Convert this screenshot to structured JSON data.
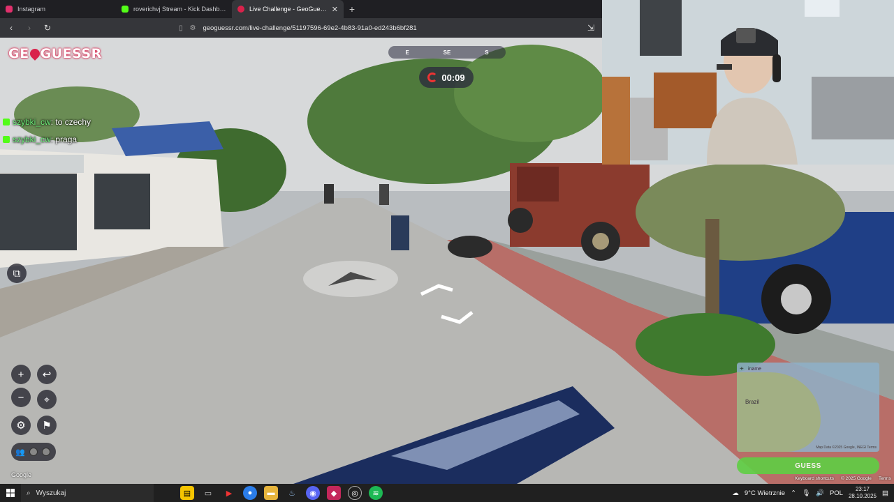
{
  "browser": {
    "tabs": [
      {
        "label": "Instagram",
        "color": "#e1306c",
        "active": false
      },
      {
        "label": "roverichvj Stream - Kick Dashboard",
        "color": "#53fc18",
        "active": false
      },
      {
        "label": "Live Challenge - GeoGuessr",
        "color": "#d9224b",
        "active": true
      }
    ],
    "url": "geoguessr.com/live-challenge/51197596-69e2-4b83-91a0-ed243b6bf281"
  },
  "game": {
    "logo_left": "GE",
    "logo_right": "GUESSR",
    "compass": [
      "E",
      "SE",
      "S"
    ],
    "timer": "00:09",
    "guess_label": "GUESS",
    "google_label": "Google",
    "minimap": {
      "country_label": "Brazil",
      "top_label": "iname",
      "attribution": "Map Data ©2025 Google, INEGI   Terms"
    },
    "keyboard_shortcuts": "Keyboard shortcuts",
    "copyright": "© 2025 Google",
    "terms": "Terms"
  },
  "chat": [
    {
      "user": "szybki_cw",
      "message": ": to czechy"
    },
    {
      "user": "szybki_cw",
      "message": ": praga"
    }
  ],
  "taskbar": {
    "search_placeholder": "Wyszukaj",
    "weather": "9°C  Wietrznie",
    "language": "POL",
    "time": "23:17",
    "date": "28.10.2025"
  }
}
